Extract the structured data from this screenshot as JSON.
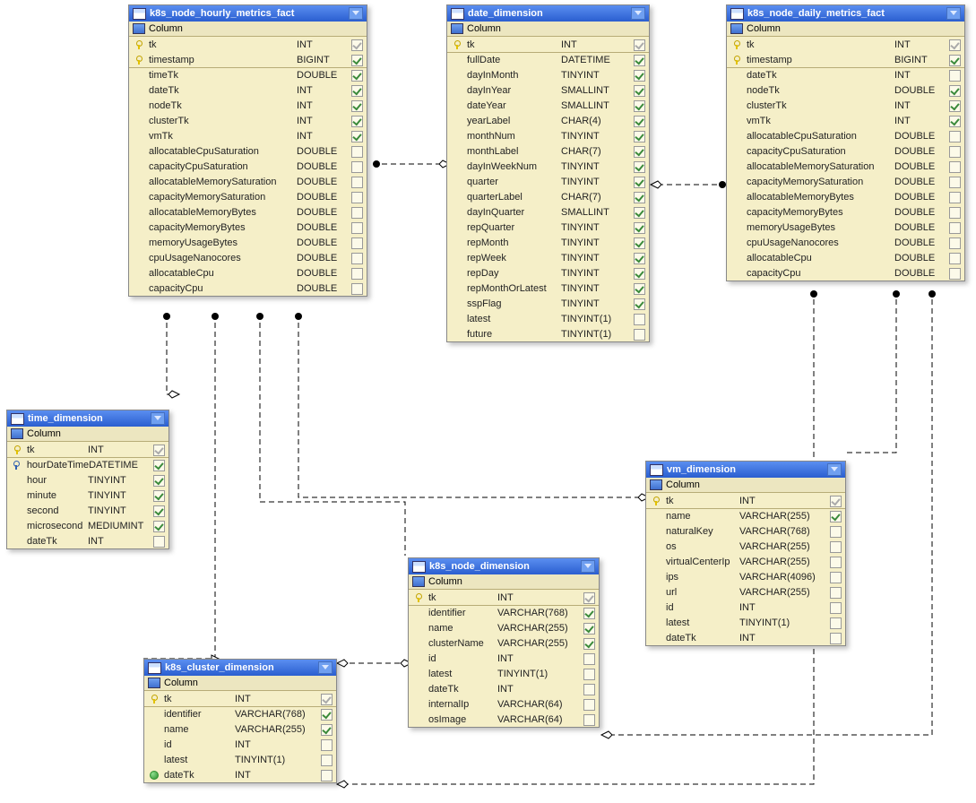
{
  "column_label": "Column",
  "tables": {
    "hourly": {
      "title": "k8s_node_hourly_metrics_fact",
      "rows": [
        {
          "key": "pk",
          "name": "tk",
          "type": "INT",
          "chk": "gray"
        },
        {
          "key": "pk",
          "name": "timestamp",
          "type": "BIGINT",
          "chk": "on"
        },
        {
          "sep": true,
          "name": "timeTk",
          "type": "DOUBLE",
          "chk": "on"
        },
        {
          "name": "dateTk",
          "type": "INT",
          "chk": "on"
        },
        {
          "name": "nodeTk",
          "type": "INT",
          "chk": "on"
        },
        {
          "name": "clusterTk",
          "type": "INT",
          "chk": "on"
        },
        {
          "name": "vmTk",
          "type": "INT",
          "chk": "on"
        },
        {
          "name": "allocatableCpuSaturation",
          "type": "DOUBLE",
          "chk": "off"
        },
        {
          "name": "capacityCpuSaturation",
          "type": "DOUBLE",
          "chk": "off"
        },
        {
          "name": "allocatableMemorySaturation",
          "type": "DOUBLE",
          "chk": "off"
        },
        {
          "name": "capacityMemorySaturation",
          "type": "DOUBLE",
          "chk": "off"
        },
        {
          "name": "allocatableMemoryBytes",
          "type": "DOUBLE",
          "chk": "off"
        },
        {
          "name": "capacityMemoryBytes",
          "type": "DOUBLE",
          "chk": "off"
        },
        {
          "name": "memoryUsageBytes",
          "type": "DOUBLE",
          "chk": "off"
        },
        {
          "name": "cpuUsageNanocores",
          "type": "DOUBLE",
          "chk": "off"
        },
        {
          "name": "allocatableCpu",
          "type": "DOUBLE",
          "chk": "off"
        },
        {
          "name": "capacityCpu",
          "type": "DOUBLE",
          "chk": "off"
        }
      ]
    },
    "date": {
      "title": "date_dimension",
      "rows": [
        {
          "key": "pk",
          "name": "tk",
          "type": "INT",
          "chk": "gray"
        },
        {
          "sep": true,
          "name": "fullDate",
          "type": "DATETIME",
          "chk": "on"
        },
        {
          "name": "dayInMonth",
          "type": "TINYINT",
          "chk": "on"
        },
        {
          "name": "dayInYear",
          "type": "SMALLINT",
          "chk": "on"
        },
        {
          "name": "dateYear",
          "type": "SMALLINT",
          "chk": "on"
        },
        {
          "name": "yearLabel",
          "type": "CHAR(4)",
          "chk": "on"
        },
        {
          "name": "monthNum",
          "type": "TINYINT",
          "chk": "on"
        },
        {
          "name": "monthLabel",
          "type": "CHAR(7)",
          "chk": "on"
        },
        {
          "name": "dayInWeekNum",
          "type": "TINYINT",
          "chk": "on"
        },
        {
          "name": "quarter",
          "type": "TINYINT",
          "chk": "on"
        },
        {
          "name": "quarterLabel",
          "type": "CHAR(7)",
          "chk": "on"
        },
        {
          "name": "dayInQuarter",
          "type": "SMALLINT",
          "chk": "on"
        },
        {
          "name": "repQuarter",
          "type": "TINYINT",
          "chk": "on"
        },
        {
          "name": "repMonth",
          "type": "TINYINT",
          "chk": "on"
        },
        {
          "name": "repWeek",
          "type": "TINYINT",
          "chk": "on"
        },
        {
          "name": "repDay",
          "type": "TINYINT",
          "chk": "on"
        },
        {
          "name": "repMonthOrLatest",
          "type": "TINYINT",
          "chk": "on"
        },
        {
          "name": "sspFlag",
          "type": "TINYINT",
          "chk": "on"
        },
        {
          "name": "latest",
          "type": "TINYINT(1)",
          "chk": "off"
        },
        {
          "name": "future",
          "type": "TINYINT(1)",
          "chk": "off"
        }
      ]
    },
    "daily": {
      "title": "k8s_node_daily_metrics_fact",
      "rows": [
        {
          "key": "pk",
          "name": "tk",
          "type": "INT",
          "chk": "gray"
        },
        {
          "key": "pk",
          "name": "timestamp",
          "type": "BIGINT",
          "chk": "on"
        },
        {
          "sep": true,
          "name": "dateTk",
          "type": "INT",
          "chk": "off"
        },
        {
          "name": "nodeTk",
          "type": "DOUBLE",
          "chk": "on"
        },
        {
          "name": "clusterTk",
          "type": "INT",
          "chk": "on"
        },
        {
          "name": "vmTk",
          "type": "INT",
          "chk": "on"
        },
        {
          "name": "allocatableCpuSaturation",
          "type": "DOUBLE",
          "chk": "off"
        },
        {
          "name": "capacityCpuSaturation",
          "type": "DOUBLE",
          "chk": "off"
        },
        {
          "name": "allocatableMemorySaturation",
          "type": "DOUBLE",
          "chk": "off"
        },
        {
          "name": "capacityMemorySaturation",
          "type": "DOUBLE",
          "chk": "off"
        },
        {
          "name": "allocatableMemoryBytes",
          "type": "DOUBLE",
          "chk": "off"
        },
        {
          "name": "capacityMemoryBytes",
          "type": "DOUBLE",
          "chk": "off"
        },
        {
          "name": "memoryUsageBytes",
          "type": "DOUBLE",
          "chk": "off"
        },
        {
          "name": "cpuUsageNanocores",
          "type": "DOUBLE",
          "chk": "off"
        },
        {
          "name": "allocatableCpu",
          "type": "DOUBLE",
          "chk": "off"
        },
        {
          "name": "capacityCpu",
          "type": "DOUBLE",
          "chk": "off"
        }
      ]
    },
    "time": {
      "title": "time_dimension",
      "rows": [
        {
          "key": "pk",
          "name": "tk",
          "type": "INT",
          "chk": "gray"
        },
        {
          "sep": true,
          "key": "pkblue",
          "name": "hourDateTime",
          "type": "DATETIME",
          "chk": "on"
        },
        {
          "name": "hour",
          "type": "TINYINT",
          "chk": "on"
        },
        {
          "name": "minute",
          "type": "TINYINT",
          "chk": "on"
        },
        {
          "name": "second",
          "type": "TINYINT",
          "chk": "on"
        },
        {
          "name": "microsecond",
          "type": "MEDIUMINT",
          "chk": "on"
        },
        {
          "name": "dateTk",
          "type": "INT",
          "chk": "off"
        }
      ]
    },
    "vm": {
      "title": "vm_dimension",
      "rows": [
        {
          "key": "pk",
          "name": "tk",
          "type": "INT",
          "chk": "gray"
        },
        {
          "sep": true,
          "name": "name",
          "type": "VARCHAR(255)",
          "chk": "on"
        },
        {
          "name": "naturalKey",
          "type": "VARCHAR(768)",
          "chk": "off"
        },
        {
          "name": "os",
          "type": "VARCHAR(255)",
          "chk": "off"
        },
        {
          "name": "virtualCenterIp",
          "type": "VARCHAR(255)",
          "chk": "off"
        },
        {
          "name": "ips",
          "type": "VARCHAR(4096)",
          "chk": "off"
        },
        {
          "name": "url",
          "type": "VARCHAR(255)",
          "chk": "off"
        },
        {
          "name": "id",
          "type": "INT",
          "chk": "off"
        },
        {
          "name": "latest",
          "type": "TINYINT(1)",
          "chk": "off"
        },
        {
          "name": "dateTk",
          "type": "INT",
          "chk": "off"
        }
      ]
    },
    "node": {
      "title": "k8s_node_dimension",
      "rows": [
        {
          "key": "pk",
          "name": "tk",
          "type": "INT",
          "chk": "gray"
        },
        {
          "sep": true,
          "name": "identifier",
          "type": "VARCHAR(768)",
          "chk": "on"
        },
        {
          "name": "name",
          "type": "VARCHAR(255)",
          "chk": "on"
        },
        {
          "name": "clusterName",
          "type": "VARCHAR(255)",
          "chk": "on"
        },
        {
          "name": "id",
          "type": "INT",
          "chk": "off"
        },
        {
          "name": "latest",
          "type": "TINYINT(1)",
          "chk": "off"
        },
        {
          "name": "dateTk",
          "type": "INT",
          "chk": "off"
        },
        {
          "name": "internalIp",
          "type": "VARCHAR(64)",
          "chk": "off"
        },
        {
          "name": "osImage",
          "type": "VARCHAR(64)",
          "chk": "off"
        }
      ]
    },
    "cluster": {
      "title": "k8s_cluster_dimension",
      "rows": [
        {
          "key": "pk",
          "name": "tk",
          "type": "INT",
          "chk": "gray"
        },
        {
          "sep": true,
          "name": "identifier",
          "type": "VARCHAR(768)",
          "chk": "on"
        },
        {
          "name": "name",
          "type": "VARCHAR(255)",
          "chk": "on"
        },
        {
          "name": "id",
          "type": "INT",
          "chk": "off"
        },
        {
          "name": "latest",
          "type": "TINYINT(1)",
          "chk": "off"
        },
        {
          "key": "fk",
          "name": "dateTk",
          "type": "INT",
          "chk": "off"
        }
      ]
    }
  }
}
